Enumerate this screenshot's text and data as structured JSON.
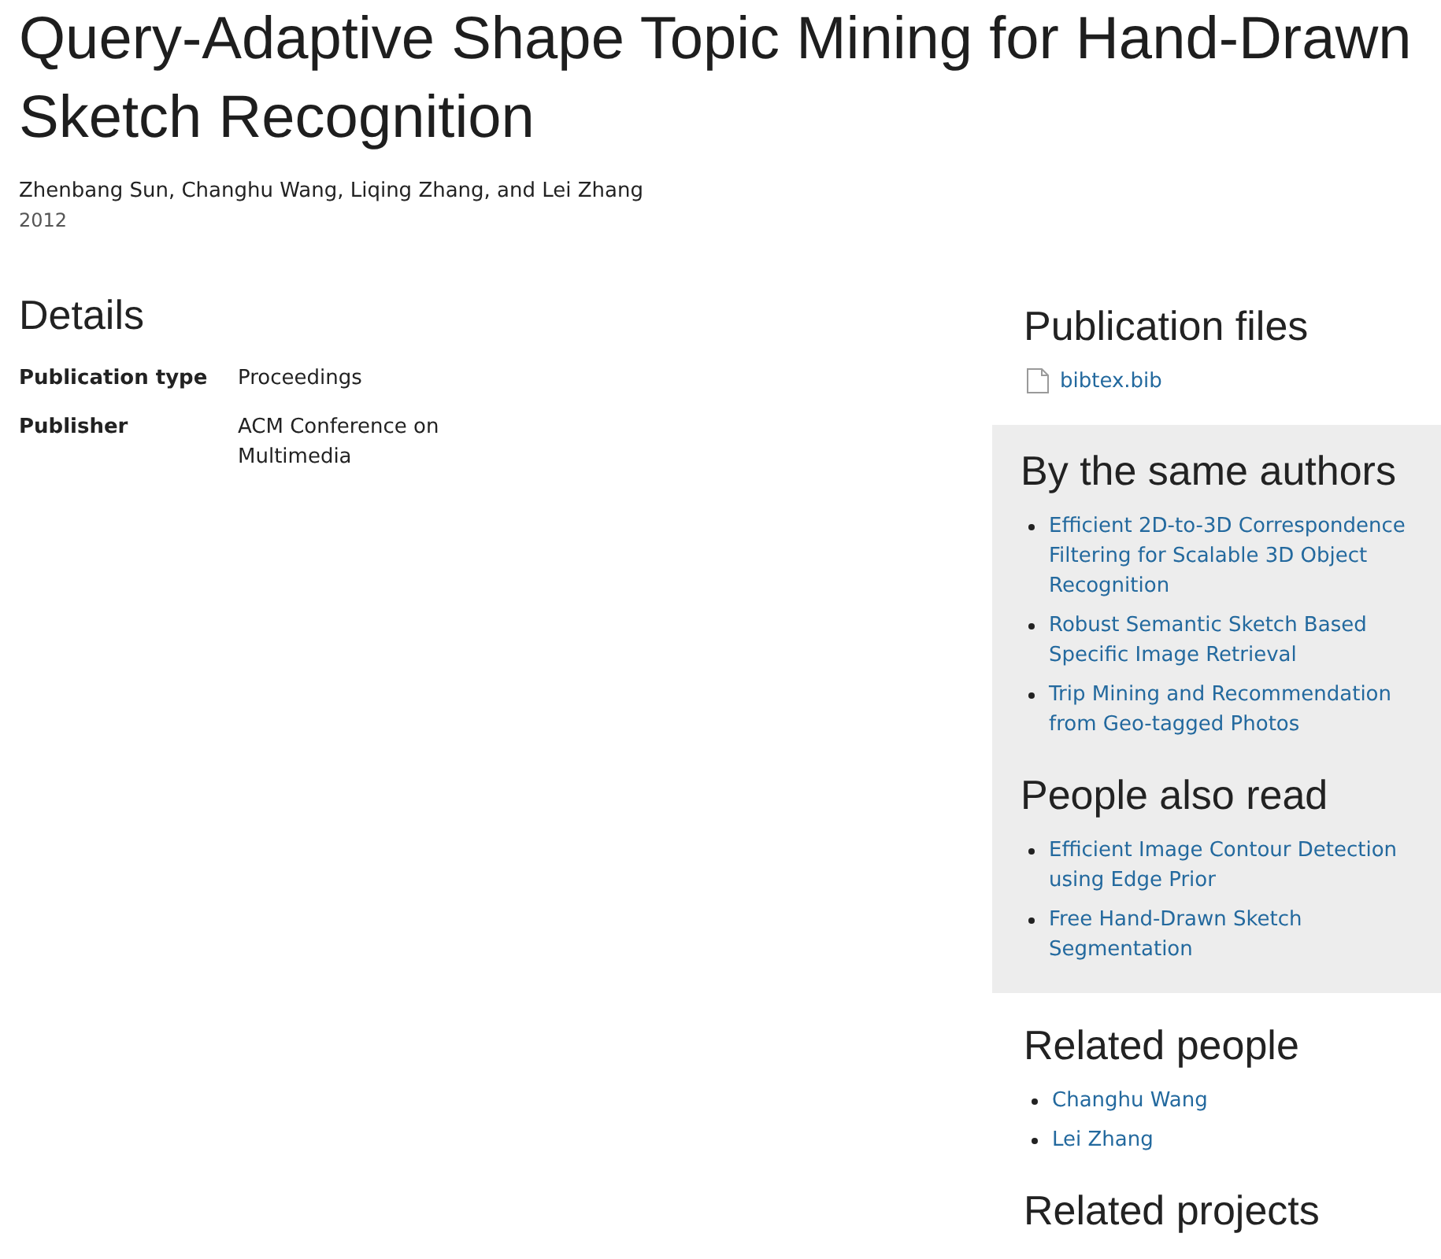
{
  "title": "Query-Adaptive Shape Topic Mining for Hand-Drawn Sketch Recognition",
  "authors": "Zhenbang Sun, Changhu Wang, Liqing Zhang, and Lei Zhang",
  "year": "2012",
  "details": {
    "heading": "Details",
    "fields": [
      {
        "label": "Publication type",
        "value": "Proceedings"
      },
      {
        "label": "Publisher",
        "value": "ACM Conference on Multimedia"
      }
    ]
  },
  "sidebar": [
    {
      "kind": "files",
      "heading": "Publication files",
      "items": [
        "bibtex.bib"
      ]
    },
    {
      "kind": "panel",
      "sections": [
        {
          "heading": "By the same authors",
          "items": [
            "Efficient 2D-to-3D Correspondence Filtering for Scalable 3D Object Recognition",
            "Robust Semantic Sketch Based Specific Image Retrieval",
            "Trip Mining and Recommendation from Geo-tagged Photos"
          ]
        },
        {
          "heading": "People also read",
          "items": [
            "Efficient Image Contour Detection using Edge Prior",
            "Free Hand-Drawn Sketch Segmentation"
          ]
        }
      ]
    },
    {
      "kind": "links",
      "heading": "Related people",
      "items": [
        "Changhu Wang",
        "Lei Zhang"
      ]
    },
    {
      "kind": "links",
      "heading": "Related projects"
    }
  ]
}
